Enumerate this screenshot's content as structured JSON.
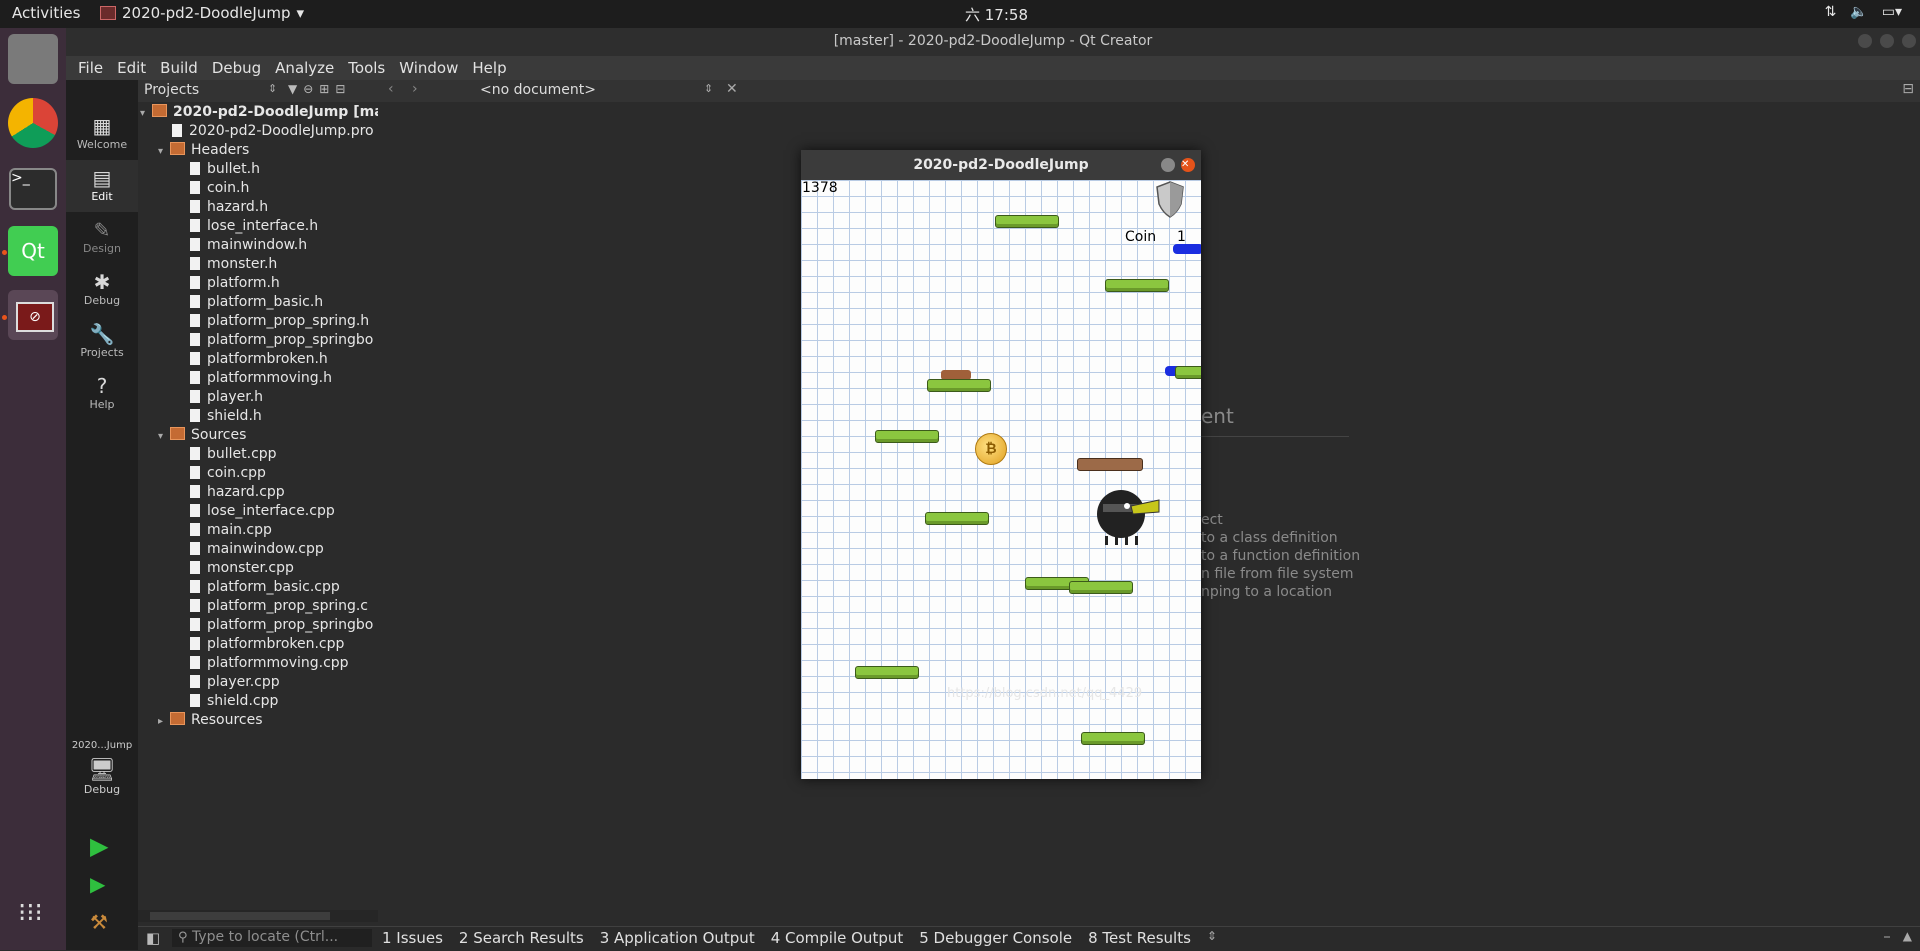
{
  "topbar": {
    "activities": "Activities",
    "app_menu": "2020-pd2-DoodleJump",
    "clock": "六 17:58"
  },
  "window": {
    "title": "[master] - 2020-pd2-DoodleJump - Qt Creator"
  },
  "menubar": {
    "items": [
      "File",
      "Edit",
      "Build",
      "Debug",
      "Analyze",
      "Tools",
      "Window",
      "Help"
    ]
  },
  "modes": {
    "items": [
      "Welcome",
      "Edit",
      "Design",
      "Debug",
      "Projects",
      "Help"
    ],
    "target_name": "2020...Jump",
    "target_mode": "Debug"
  },
  "projects": {
    "selector": "Projects",
    "document": "<no document>",
    "root": "2020-pd2-DoodleJump [mas",
    "pro_file": "2020-pd2-DoodleJump.pro",
    "headers_label": "Headers",
    "headers": [
      "bullet.h",
      "coin.h",
      "hazard.h",
      "lose_interface.h",
      "mainwindow.h",
      "monster.h",
      "platform.h",
      "platform_basic.h",
      "platform_prop_spring.h",
      "platform_prop_springbo",
      "platformbroken.h",
      "platformmoving.h",
      "player.h",
      "shield.h"
    ],
    "sources_label": "Sources",
    "sources": [
      "bullet.cpp",
      "coin.cpp",
      "hazard.cpp",
      "lose_interface.cpp",
      "main.cpp",
      "mainwindow.cpp",
      "monster.cpp",
      "platform_basic.cpp",
      "platform_prop_spring.c",
      "platform_prop_springbo",
      "platformbroken.cpp",
      "platformmoving.cpp",
      "player.cpp",
      "shield.cpp"
    ],
    "resources_label": "Resources"
  },
  "editor_ghost": {
    "heading": "ent",
    "lines": [
      "ect",
      "to a class definition",
      "to a function definition",
      "n file from file system",
      "nping to a location"
    ]
  },
  "bottombar": {
    "locator_placeholder": "Type to locate (Ctrl...",
    "tabs": [
      "1  Issues",
      "2  Search Results",
      "3  Application Output",
      "4  Compile Output",
      "5  Debugger Console",
      "8  Test Results"
    ]
  },
  "game": {
    "title": "2020-pd2-DoodleJump",
    "score": "1378",
    "coin_label": "Coin",
    "coin_count": "1",
    "watermark": "https://blog.csdn.net/qq_4429"
  }
}
